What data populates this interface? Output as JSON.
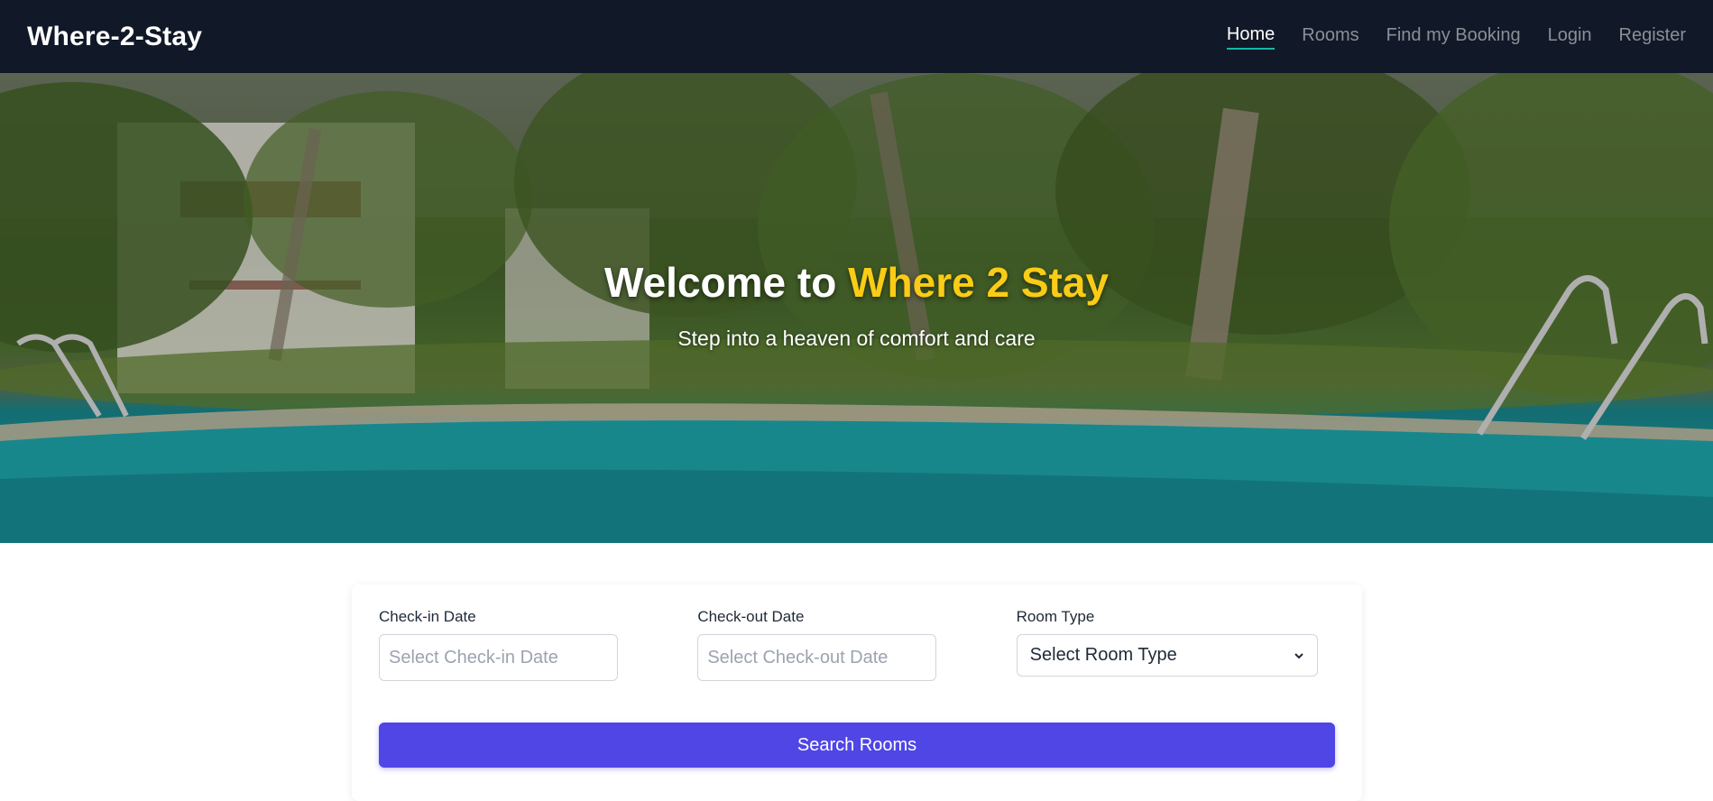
{
  "nav": {
    "brand": "Where-2-Stay",
    "links": [
      {
        "label": "Home"
      },
      {
        "label": "Rooms"
      },
      {
        "label": "Find my Booking"
      },
      {
        "label": "Login"
      },
      {
        "label": "Register"
      }
    ]
  },
  "hero": {
    "title_prefix": "Welcome to ",
    "title_accent": "Where 2 Stay",
    "subtitle": "Step into a heaven of comfort and care"
  },
  "search": {
    "checkin_label": "Check-in Date",
    "checkin_placeholder": "Select Check-in Date",
    "checkout_label": "Check-out Date",
    "checkout_placeholder": "Select Check-out Date",
    "room_type_label": "Room Type",
    "room_type_selected": "Select Room Type",
    "button_label": "Search Rooms"
  },
  "colors": {
    "nav_bg": "#111827",
    "accent_yellow": "#facc15",
    "primary_button": "#4f46e5",
    "active_underline": "#14b8a6"
  }
}
